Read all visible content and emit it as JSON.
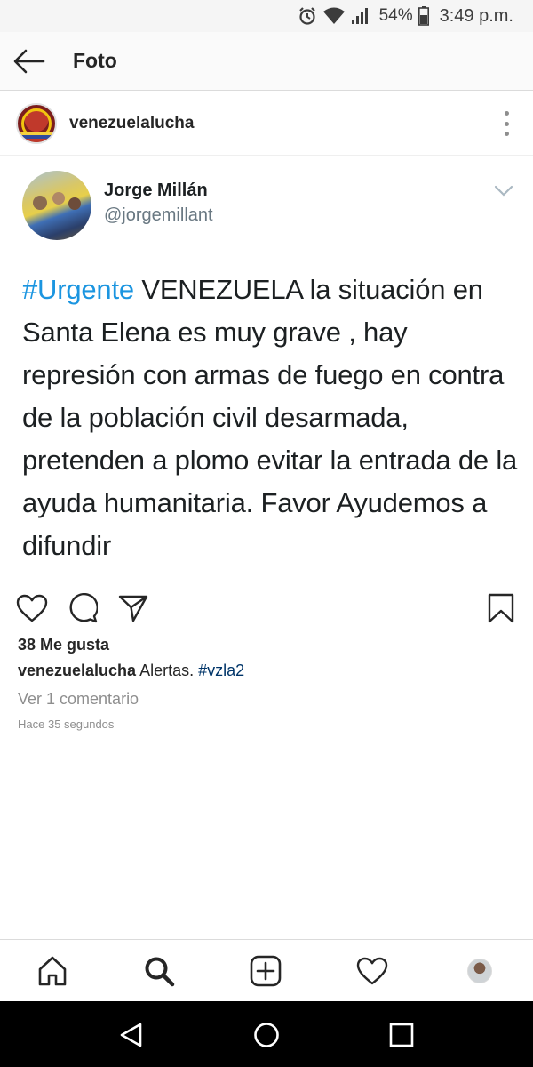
{
  "status_bar": {
    "battery_percent": "54%",
    "time": "3:49 p.m.",
    "icons": [
      "alarm-icon",
      "wifi-icon",
      "signal-icon",
      "battery-icon"
    ]
  },
  "header": {
    "title": "Foto",
    "back_icon": "arrow-left-icon"
  },
  "post": {
    "username": "venezuelalucha",
    "more_icon": "more-vertical-icon",
    "embedded_tweet": {
      "author_name": "Jorge Millán",
      "author_handle": "@jorgemillant",
      "hashtag": "#Urgente",
      "body": " VENEZUELA la situación en Santa Elena es muy grave , hay represión con armas de fuego en contra de la población civil desarmada, pretenden a plomo evitar la entrada de la ayuda humanitaria. Favor Ayudemos a difundir",
      "hashtag_color": "#1b95e0"
    },
    "likes": "38 Me gusta",
    "caption": {
      "username": "venezuelalucha",
      "text": " Alertas. ",
      "hashtag": "#vzla2"
    },
    "comments_link": "Ver 1 comentario",
    "timestamp": "Hace 35 segundos"
  },
  "actions": [
    "heart-icon",
    "comment-icon",
    "share-icon",
    "bookmark-icon"
  ],
  "bottom_nav": [
    "home-icon",
    "search-icon",
    "add-post-icon",
    "activity-heart-icon",
    "profile-avatar"
  ],
  "system_nav": [
    "back-triangle-icon",
    "home-circle-icon",
    "recents-square-icon"
  ],
  "colors": {
    "link": "#003569",
    "muted": "#8e8e8e",
    "tweet_link": "#1b95e0",
    "text": "#262626"
  }
}
